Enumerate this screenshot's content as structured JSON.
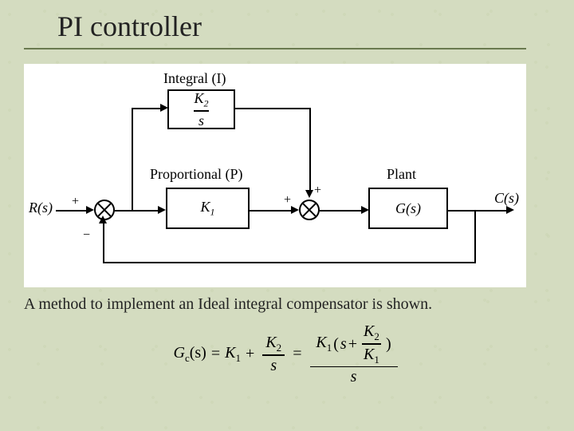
{
  "title": "PI controller",
  "caption": "A method to implement an Ideal integral compensator is shown.",
  "diagram": {
    "integral_label": "Integral (I)",
    "proportional_label": "Proportional (P)",
    "plant_label": "Plant",
    "input": "R(s)",
    "output": "C(s)",
    "k1": "K",
    "k1_sub": "1",
    "k2": "K",
    "k2_sub": "2",
    "s": "s",
    "g": "G(s)",
    "plus": "+",
    "minus": "−"
  },
  "equation": {
    "gc": "G",
    "c_sub": "c",
    "s_arg": "(s)",
    "eq": "=",
    "k1": "K",
    "sub1": "1",
    "plus": "+",
    "k2": "K",
    "sub2": "2",
    "s": "s",
    "lparen": "(",
    "rparen": ")"
  }
}
